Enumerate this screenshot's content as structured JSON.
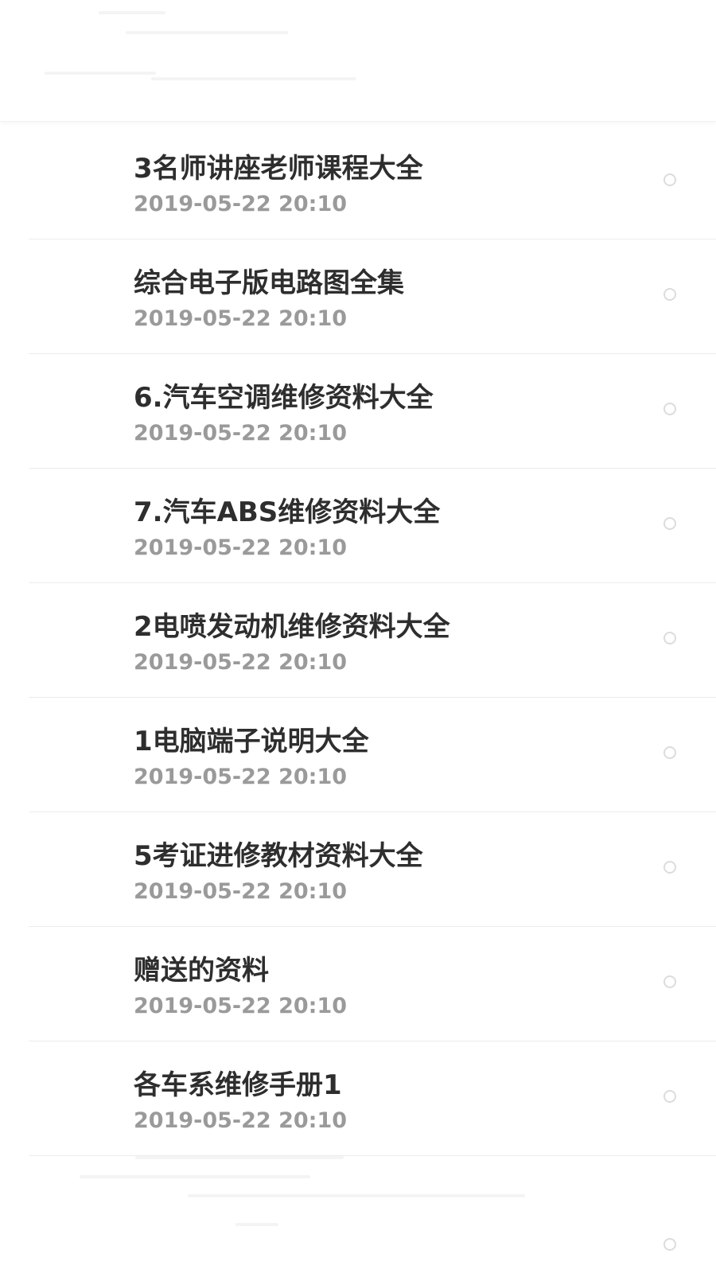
{
  "files": [
    {
      "name": "3名师讲座老师课程大全",
      "date": "2019-05-22 20:10"
    },
    {
      "name": "综合电子版电路图全集",
      "date": "2019-05-22 20:10"
    },
    {
      "name": "6.汽车空调维修资料大全",
      "date": "2019-05-22 20:10"
    },
    {
      "name": "7.汽车ABS维修资料大全",
      "date": "2019-05-22 20:10"
    },
    {
      "name": "2电喷发动机维修资料大全",
      "date": "2019-05-22 20:10"
    },
    {
      "name": "1电脑端子说明大全",
      "date": "2019-05-22 20:10"
    },
    {
      "name": "5考证进修教材资料大全",
      "date": "2019-05-22 20:10"
    },
    {
      "name": "赠送的资料",
      "date": "2019-05-22 20:10"
    },
    {
      "name": "各车系维修手册1",
      "date": "2019-05-22 20:10"
    }
  ],
  "icons": {
    "select": "radio-unchecked-icon"
  },
  "colors": {
    "title": "#2e2e2e",
    "date": "#9a9a9a",
    "divider": "#ececec",
    "radio_border": "#dcdcdc"
  }
}
